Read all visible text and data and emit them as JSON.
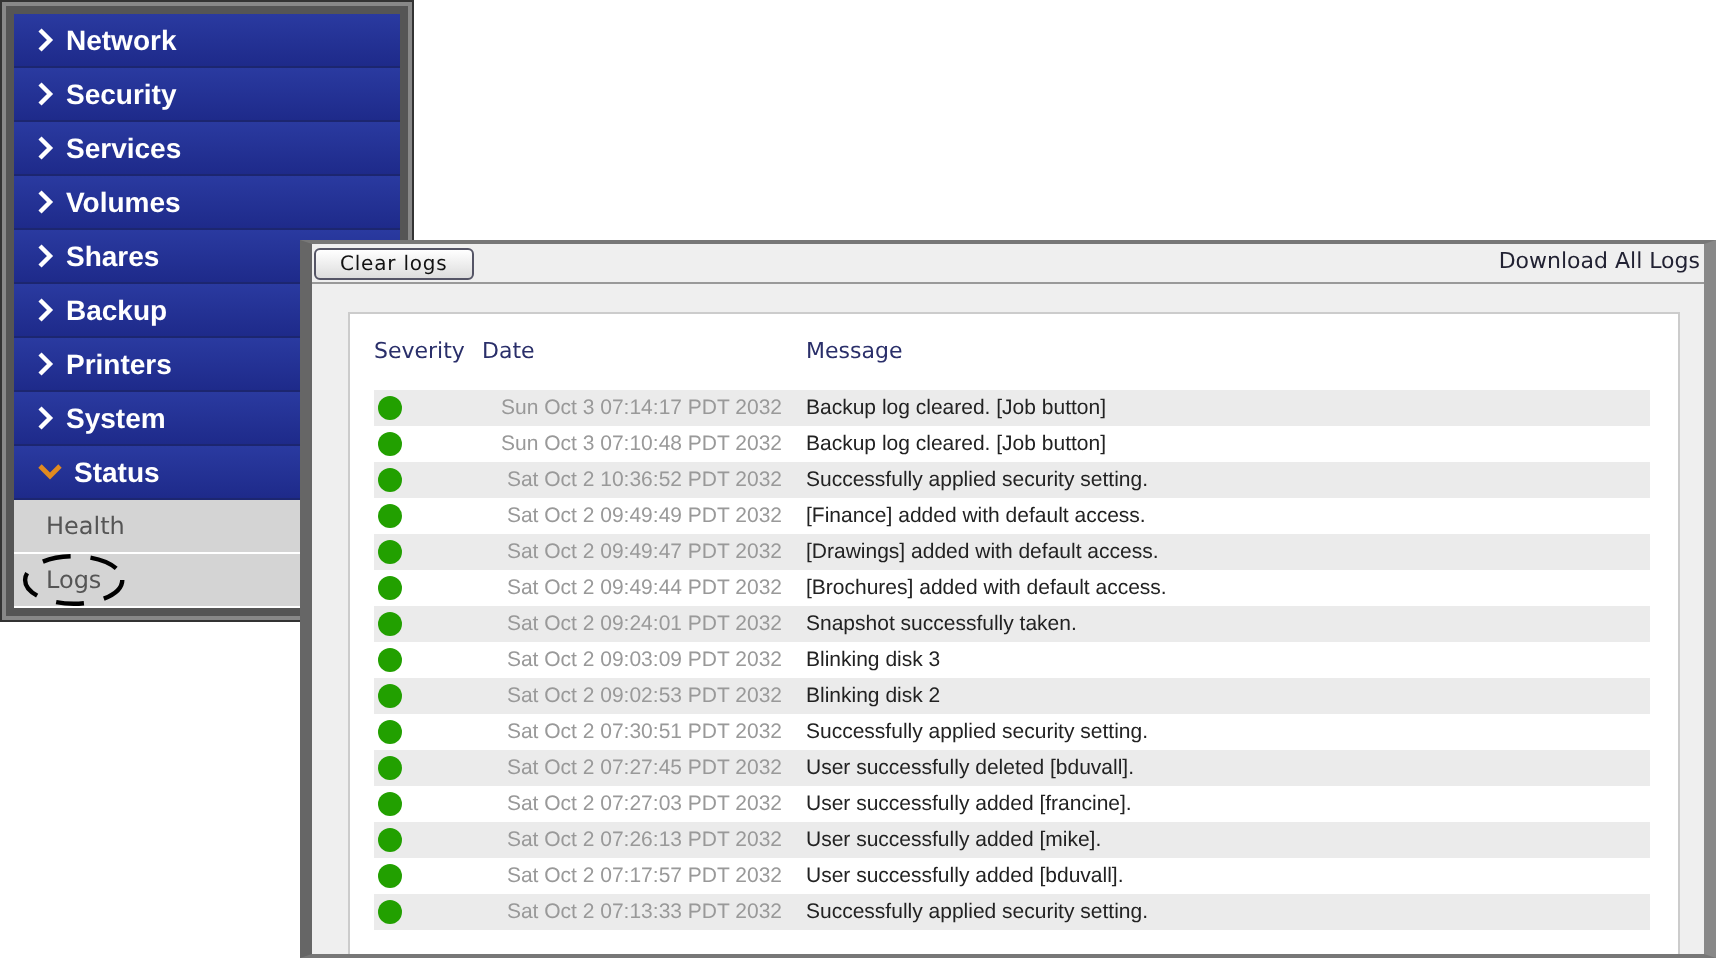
{
  "sidebar": {
    "items": [
      {
        "label": "Network",
        "expanded": false
      },
      {
        "label": "Security",
        "expanded": false
      },
      {
        "label": "Services",
        "expanded": false
      },
      {
        "label": "Volumes",
        "expanded": false
      },
      {
        "label": "Shares",
        "expanded": false
      },
      {
        "label": "Backup",
        "expanded": false
      },
      {
        "label": "Printers",
        "expanded": false
      },
      {
        "label": "System",
        "expanded": false
      },
      {
        "label": "Status",
        "expanded": true,
        "children": [
          {
            "label": "Health",
            "highlighted": false
          },
          {
            "label": "Logs",
            "highlighted": true
          }
        ]
      }
    ]
  },
  "logs_window": {
    "clear_button": "Clear logs",
    "download_link": "Download All Logs",
    "table": {
      "columns": [
        "Severity",
        "Date",
        "Message"
      ],
      "rows": [
        {
          "color": "#22a000",
          "date": "Sun Oct 3 07:14:17 PDT 2032",
          "message": "Backup log cleared. [Job button]"
        },
        {
          "color": "#22a000",
          "date": "Sun Oct 3 07:10:48 PDT 2032",
          "message": "Backup log cleared. [Job button]"
        },
        {
          "color": "#22a000",
          "date": "Sat Oct 2 10:36:52 PDT 2032",
          "message": "Successfully applied security setting."
        },
        {
          "color": "#22a000",
          "date": "Sat Oct 2 09:49:49 PDT 2032",
          "message": "[Finance] added with default access."
        },
        {
          "color": "#22a000",
          "date": "Sat Oct 2 09:49:47 PDT 2032",
          "message": "[Drawings] added with default access."
        },
        {
          "color": "#22a000",
          "date": "Sat Oct 2 09:49:44 PDT 2032",
          "message": "[Brochures] added with default access."
        },
        {
          "color": "#22a000",
          "date": "Sat Oct 2 09:24:01 PDT 2032",
          "message": "Snapshot successfully taken."
        },
        {
          "color": "#22a000",
          "date": "Sat Oct 2 09:03:09 PDT 2032",
          "message": "Blinking disk 3"
        },
        {
          "color": "#22a000",
          "date": "Sat Oct 2 09:02:53 PDT 2032",
          "message": "Blinking disk 2"
        },
        {
          "color": "#22a000",
          "date": "Sat Oct 2 07:30:51 PDT 2032",
          "message": "Successfully applied security setting."
        },
        {
          "color": "#22a000",
          "date": "Sat Oct 2 07:27:45 PDT 2032",
          "message": "User successfully deleted [bduvall]."
        },
        {
          "color": "#22a000",
          "date": "Sat Oct 2 07:27:03 PDT 2032",
          "message": "User successfully added [francine]."
        },
        {
          "color": "#22a000",
          "date": "Sat Oct 2 07:26:13 PDT 2032",
          "message": "User successfully added [mike]."
        },
        {
          "color": "#22a000",
          "date": "Sat Oct 2 07:17:57 PDT 2032",
          "message": "User successfully added [bduvall]."
        },
        {
          "color": "#22a000",
          "date": "Sat Oct 2 07:13:33 PDT 2032",
          "message": "Successfully applied security setting."
        }
      ]
    }
  }
}
